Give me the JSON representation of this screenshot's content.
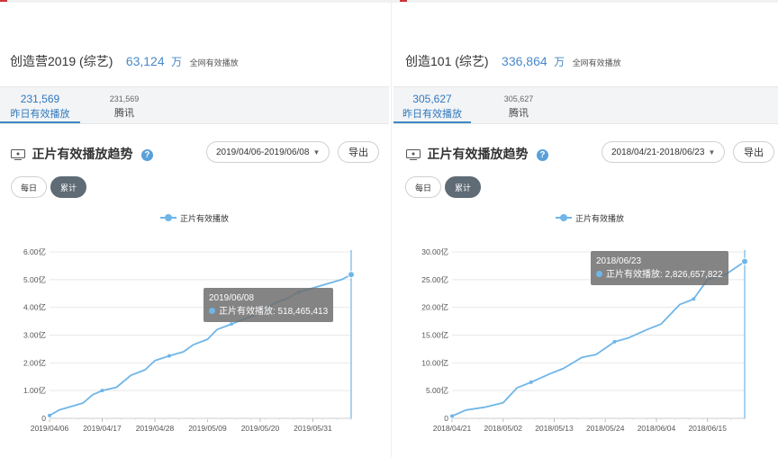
{
  "panels": [
    {
      "show_title": "创造营2019 (综艺)",
      "total_count": "63,124",
      "total_unit": "万",
      "total_note": "全网有效播放",
      "stats": {
        "yesterday_value": "231,569",
        "yesterday_label": "昨日有效播放",
        "platform_value": "231,569",
        "platform_label": "腾讯"
      },
      "trend_title": "正片有效播放趋势",
      "help_icon": "?",
      "date_range": "2019/04/06-2019/06/08",
      "export_label": "导出",
      "toggle_daily": "每日",
      "toggle_cumulative": "累计",
      "legend_label": "正片有效播放",
      "tooltip": {
        "date": "2019/06/08",
        "label": "正片有效播放: 518,465,413"
      },
      "chart_data": {
        "type": "line",
        "series": [
          {
            "name": "正片有效播放",
            "x": [
              "2019/04/06",
              "2019/04/08",
              "2019/04/11",
              "2019/04/13",
              "2019/04/15",
              "2019/04/17",
              "2019/04/20",
              "2019/04/23",
              "2019/04/26",
              "2019/04/28",
              "2019/05/01",
              "2019/05/04",
              "2019/05/06",
              "2019/05/09",
              "2019/05/11",
              "2019/05/14",
              "2019/05/17",
              "2019/05/20",
              "2019/05/23",
              "2019/05/26",
              "2019/05/28",
              "2019/05/31",
              "2019/06/03",
              "2019/06/06",
              "2019/06/08"
            ],
            "values": [
              0.1,
              0.3,
              0.45,
              0.55,
              0.85,
              1.0,
              1.12,
              1.55,
              1.75,
              2.08,
              2.25,
              2.4,
              2.65,
              2.85,
              3.2,
              3.4,
              3.6,
              3.8,
              4.15,
              4.35,
              4.55,
              4.7,
              4.85,
              5.0,
              5.18
            ]
          }
        ],
        "x_tick_labels": [
          "2019/04/06",
          "2019/04/17",
          "2019/04/28",
          "2019/05/09",
          "2019/05/20",
          "2019/05/31"
        ],
        "y_tick_labels": [
          "0",
          "1.00亿",
          "2.00亿",
          "3.00亿",
          "4.00亿",
          "5.00亿",
          "6.00亿"
        ],
        "ylim": [
          0,
          6
        ],
        "grid": true,
        "marker_color": "#6fb6e8"
      }
    },
    {
      "show_title": "创造101 (综艺)",
      "total_count": "336,864",
      "total_unit": "万",
      "total_note": "全网有效播放",
      "stats": {
        "yesterday_value": "305,627",
        "yesterday_label": "昨日有效播放",
        "platform_value": "305,627",
        "platform_label": "腾讯"
      },
      "trend_title": "正片有效播放趋势",
      "help_icon": "?",
      "date_range": "2018/04/21-2018/06/23",
      "export_label": "导出",
      "toggle_daily": "每日",
      "toggle_cumulative": "累计",
      "legend_label": "正片有效播放",
      "tooltip": {
        "date": "2018/06/23",
        "label": "正片有效播放: 2,826,657,822"
      },
      "chart_data": {
        "type": "line",
        "series": [
          {
            "name": "正片有效播放",
            "x": [
              "2018/04/21",
              "2018/04/24",
              "2018/04/28",
              "2018/05/02",
              "2018/05/05",
              "2018/05/08",
              "2018/05/12",
              "2018/05/15",
              "2018/05/19",
              "2018/05/22",
              "2018/05/26",
              "2018/05/29",
              "2018/06/02",
              "2018/06/05",
              "2018/06/09",
              "2018/06/12",
              "2018/06/15",
              "2018/06/19",
              "2018/06/23"
            ],
            "values": [
              0.4,
              1.5,
              2.0,
              2.8,
              5.5,
              6.5,
              8.0,
              9.0,
              11.0,
              11.5,
              13.8,
              14.5,
              16.0,
              17.0,
              20.5,
              21.5,
              25.0,
              26.0,
              28.27
            ]
          }
        ],
        "x_tick_labels": [
          "2018/04/21",
          "2018/05/02",
          "2018/05/13",
          "2018/05/24",
          "2018/06/04",
          "2018/06/15"
        ],
        "y_tick_labels": [
          "0",
          "5.00亿",
          "10.00亿",
          "15.00亿",
          "20.00亿",
          "25.00亿",
          "30.00亿"
        ],
        "ylim": [
          0,
          30
        ],
        "grid": true,
        "marker_color": "#6fb6e8"
      }
    }
  ]
}
